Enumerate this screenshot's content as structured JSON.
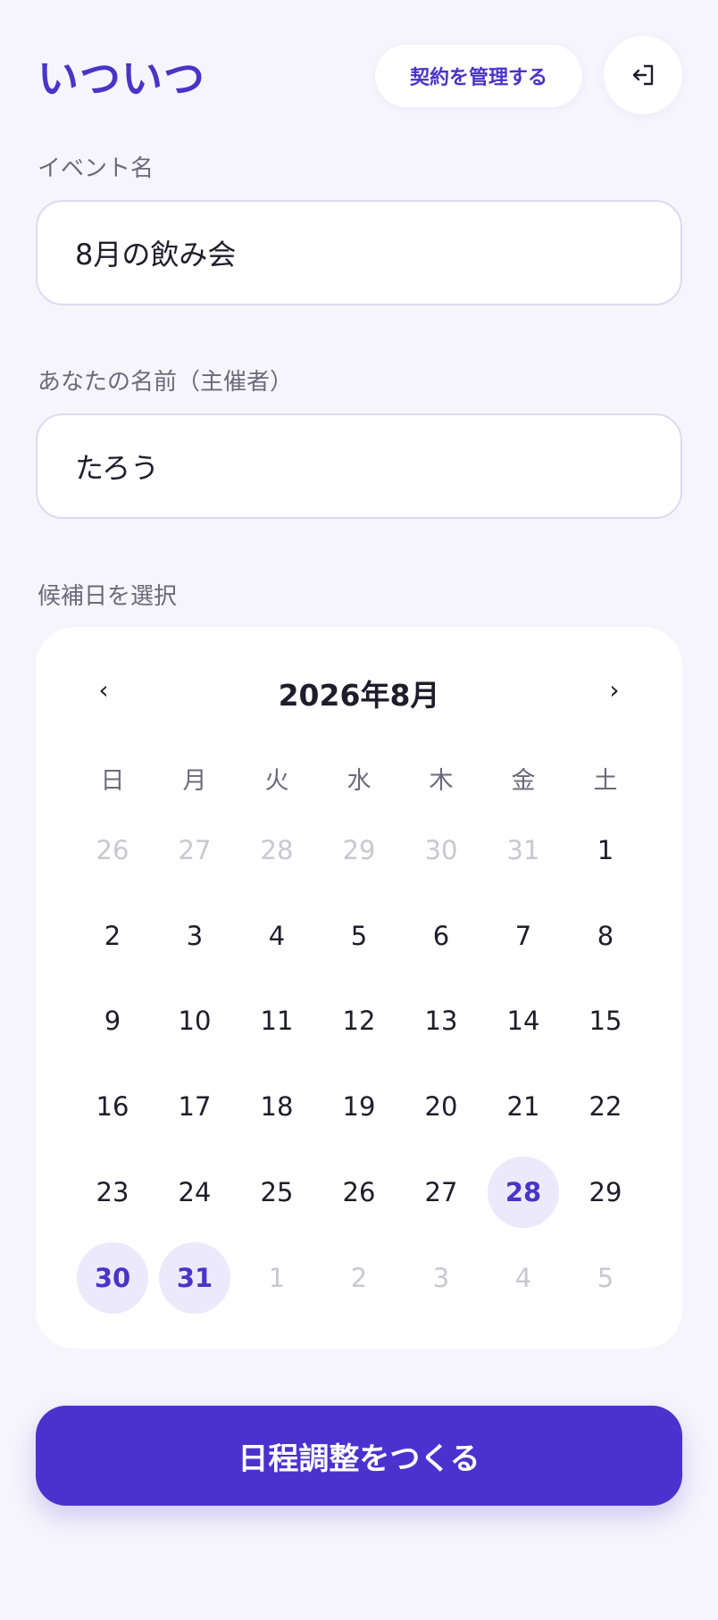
{
  "app": {
    "logo": "いついつ"
  },
  "header": {
    "manage_label": "契約を管理する"
  },
  "form": {
    "event_name_label": "イベント名",
    "event_name_value": "8月の飲み会",
    "organizer_label": "あなたの名前（主催者）",
    "organizer_value": "たろう",
    "dates_label": "候補日を選択"
  },
  "calendar": {
    "title": "2026年8月",
    "prev_label": "‹",
    "next_label": "›",
    "weekdays": [
      "日",
      "月",
      "火",
      "水",
      "木",
      "金",
      "土"
    ],
    "weeks": [
      [
        "26",
        "27",
        "28",
        "29",
        "30",
        "31",
        "1"
      ],
      [
        "2",
        "3",
        "4",
        "5",
        "6",
        "7",
        "8"
      ],
      [
        "9",
        "10",
        "11",
        "12",
        "13",
        "14",
        "15"
      ],
      [
        "16",
        "17",
        "18",
        "19",
        "20",
        "21",
        "22"
      ],
      [
        "23",
        "24",
        "25",
        "26",
        "27",
        "28",
        "29"
      ],
      [
        "30",
        "31",
        "1",
        "2",
        "3",
        "4",
        "5"
      ]
    ],
    "selected_dates": [
      "28",
      "30",
      "31"
    ]
  },
  "submit": {
    "label": "日程調整をつくる"
  },
  "icons": {
    "logout": "logout-icon"
  },
  "colors": {
    "accent": "#4a34c8",
    "button": "#4b32cf",
    "selected_bg": "#ece9fb",
    "background": "#f6f5fc"
  }
}
